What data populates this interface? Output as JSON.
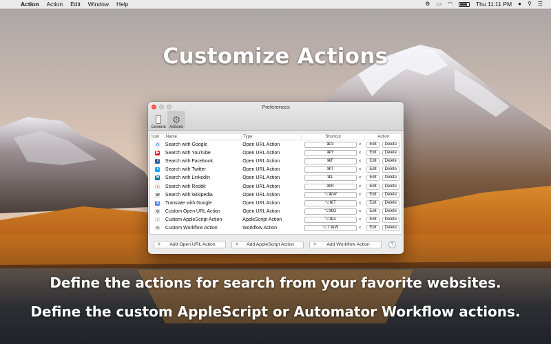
{
  "menubar": {
    "apple_icon": "apple-icon",
    "items": [
      "Action",
      "Action",
      "Edit",
      "Window",
      "Help"
    ],
    "clock": "Thu 11:11 PM"
  },
  "headlines": {
    "top": "Customize Actions",
    "middle": "Define the actions for search from your favorite websites.",
    "bottom": "Define the custom AppleScript or Automator Workflow actions."
  },
  "window": {
    "title": "Preferences",
    "tabs": [
      {
        "label": "General",
        "icon": "phone-icon",
        "active": false
      },
      {
        "label": "Actions",
        "icon": "gear-icon",
        "active": true
      }
    ],
    "table": {
      "headers": {
        "icon": "Icon",
        "name": "Name",
        "type": "Type",
        "shortcut": "Shortcut",
        "action": "Action"
      },
      "rows": [
        {
          "icon": "google-icon",
          "glyph": "G",
          "color": "#ffffff",
          "fg": "#4285f4",
          "name": "Search with Google",
          "type": "Open URL Action",
          "shortcut": "⌘G"
        },
        {
          "icon": "youtube-icon",
          "glyph": "▶",
          "color": "#e62117",
          "fg": "#ffffff",
          "name": "Search with YouTube",
          "type": "Open URL Action",
          "shortcut": "⌘Y"
        },
        {
          "icon": "facebook-icon",
          "glyph": "f",
          "color": "#3b5998",
          "fg": "#ffffff",
          "name": "Search with Facebook",
          "type": "Open URL Action",
          "shortcut": "⌘F"
        },
        {
          "icon": "twitter-icon",
          "glyph": "t",
          "color": "#1da1f2",
          "fg": "#ffffff",
          "name": "Search with Twitter",
          "type": "Open URL Action",
          "shortcut": "⌘T"
        },
        {
          "icon": "linkedin-icon",
          "glyph": "in",
          "color": "#0077b5",
          "fg": "#ffffff",
          "name": "Search with LinkedIn",
          "type": "Open URL Action",
          "shortcut": "⌘L"
        },
        {
          "icon": "reddit-icon",
          "glyph": "●",
          "color": "#ffffff",
          "fg": "#ff4500",
          "name": "Search with Reddit",
          "type": "Open URL Action",
          "shortcut": "⌘R"
        },
        {
          "icon": "wikipedia-icon",
          "glyph": "W",
          "color": "#ffffff",
          "fg": "#333333",
          "name": "Search with Wikipedia",
          "type": "Open URL Action",
          "shortcut": "⌥⌘W"
        },
        {
          "icon": "translate-icon",
          "glyph": "文",
          "color": "#4285f4",
          "fg": "#ffffff",
          "name": "Translate with Google",
          "type": "Open URL Action",
          "shortcut": "⌥⌘T"
        },
        {
          "icon": "gear-icon",
          "glyph": "⚙",
          "color": "#ffffff",
          "fg": "#555555",
          "name": "Custom Open URL Action",
          "type": "Open URL Action",
          "shortcut": "⌥⌘O"
        },
        {
          "icon": "script-icon",
          "glyph": "/",
          "color": "#ffffff",
          "fg": "#444444",
          "name": "Custom AppleScript Action",
          "type": "AppleScript Action",
          "shortcut": "⌥⌘A"
        },
        {
          "icon": "automator-icon",
          "glyph": "⚙",
          "color": "#ffffff",
          "fg": "#777777",
          "name": "Custom Workflow Action",
          "type": "Workflow Action",
          "shortcut": "⌥⇧⌘W"
        }
      ],
      "clear_glyph": "×",
      "edit_label": "Edit",
      "delete_label": "Delete"
    },
    "add_buttons": [
      "Add Open URL Action",
      "Add AppleScript Action",
      "Add Workflow Action"
    ],
    "help_label": "?"
  }
}
